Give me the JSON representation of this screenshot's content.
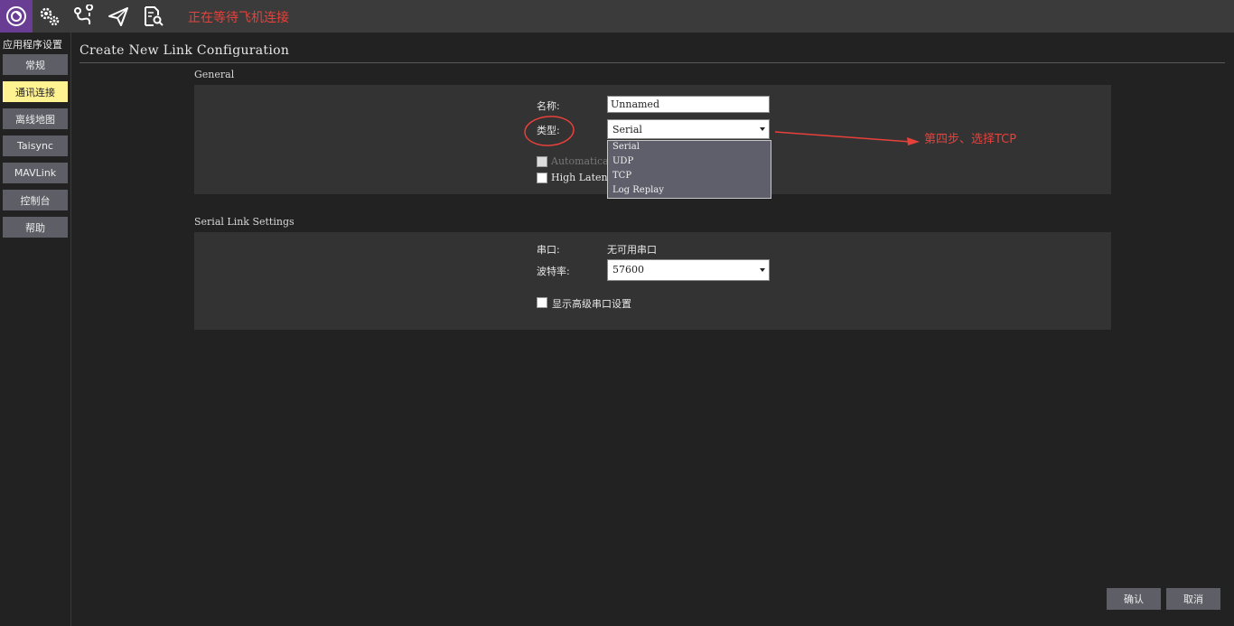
{
  "toolbar": {
    "status_text": "正在等待飞机连接",
    "buttons": [
      {
        "name": "app-settings",
        "icon": "qgc-logo-icon"
      },
      {
        "name": "vehicle-setup",
        "icon": "gears-icon"
      },
      {
        "name": "plan-view",
        "icon": "route-icon"
      },
      {
        "name": "fly-view",
        "icon": "paper-plane-icon"
      },
      {
        "name": "analyze-view",
        "icon": "document-search-icon"
      }
    ],
    "active_color": "#6a3d94"
  },
  "sidebar": {
    "title": "应用程序设置",
    "items": [
      {
        "label": "常规",
        "selected": false
      },
      {
        "label": "通讯连接",
        "selected": true
      },
      {
        "label": "离线地图",
        "selected": false
      },
      {
        "label": "Taisync",
        "selected": false
      },
      {
        "label": "MAVLink",
        "selected": false
      },
      {
        "label": "控制台",
        "selected": false
      },
      {
        "label": "帮助",
        "selected": false
      }
    ]
  },
  "main": {
    "title": "Create New Link Configuration",
    "general": {
      "section_title": "General",
      "name_label": "名称:",
      "name_value": "Unnamed",
      "type_label": "类型:",
      "type_value": "Serial",
      "type_options": [
        "Serial",
        "UDP",
        "TCP",
        "Log Replay"
      ],
      "auto_connect_label": "Automatically Connect on Start",
      "auto_connect_visible": "Automatica",
      "auto_connect_checked": false,
      "high_latency_label": "High Latency",
      "high_latency_visible": "High Latenc",
      "high_latency_checked": false
    },
    "serial": {
      "section_title": "Serial Link Settings",
      "port_label": "串口:",
      "port_value": "无可用串口",
      "baud_label": "波特率:",
      "baud_value": "57600",
      "advanced_label": "显示高级串口设置",
      "advanced_checked": false
    }
  },
  "annotation": {
    "text": "第四步、选择TCP",
    "color": "#e8403a"
  },
  "footer": {
    "ok_label": "确认",
    "cancel_label": "取消"
  }
}
